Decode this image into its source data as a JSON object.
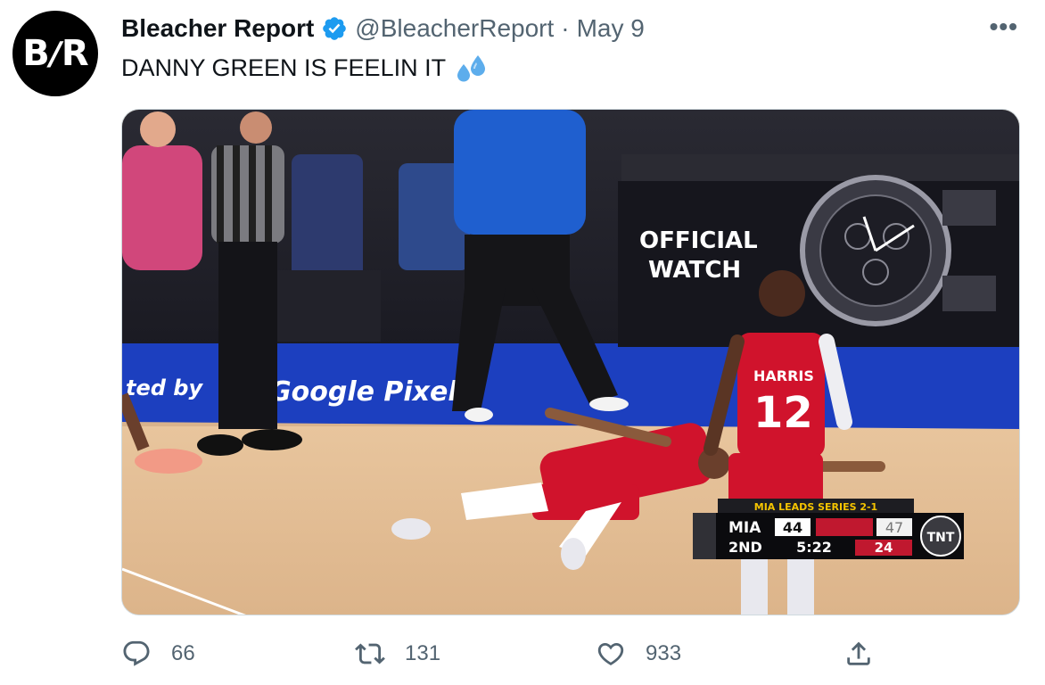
{
  "account": {
    "avatar_text_left": "B",
    "avatar_text_right": "R",
    "name": "Bleacher Report",
    "handle": "@BleacherReport",
    "separator": "·",
    "date": "May 9",
    "more_label": "•••"
  },
  "tweet": {
    "text_bold": "DANNY GREEN",
    "text_rest": " IS FEELIN IT",
    "emoji": "sweat-droplets"
  },
  "media": {
    "ad_board_line1": "OFFICIAL",
    "ad_board_line2": "WATCH",
    "court_banner": "Google Pixel",
    "court_banner_prefix": "ted by",
    "jersey_name": "HARRIS",
    "jersey_number": "12",
    "scoreboard": {
      "series_text": "MIA LEADS SERIES 2-1",
      "team": "MIA",
      "team_score": "44",
      "opp_score": "47",
      "quarter": "2ND",
      "clock": "5:22",
      "shot_clock": "24",
      "network": "TNT"
    }
  },
  "actions": {
    "reply_count": "66",
    "retweet_count": "131",
    "like_count": "933"
  },
  "colors": {
    "verified": "#1d9bf0",
    "muted": "#536471",
    "sixers_red": "#d0132c",
    "court_blue": "#1c3fbf"
  }
}
